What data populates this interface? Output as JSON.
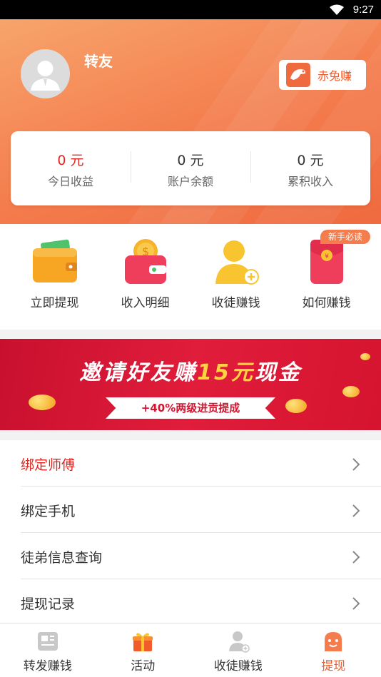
{
  "status_bar": {
    "time": "9:27"
  },
  "profile": {
    "username": "转友",
    "brand_name": "赤兔赚"
  },
  "stats": [
    {
      "value": "0 元",
      "label": "今日收益"
    },
    {
      "value": "0 元",
      "label": "账户余额"
    },
    {
      "value": "0 元",
      "label": "累积收入"
    }
  ],
  "quick_actions": [
    {
      "label": "立即提现",
      "icon": "wallet-icon"
    },
    {
      "label": "收入明细",
      "icon": "coin-purse-icon"
    },
    {
      "label": "收徒赚钱",
      "icon": "add-person-icon"
    },
    {
      "label": "如何赚钱",
      "icon": "red-envelope-icon"
    }
  ],
  "new_badge": "新手必读",
  "banner": {
    "title_part1": "邀请好友赚",
    "title_highlight": "15元",
    "title_part2": "现金",
    "subtitle": "+40%两级进贡提成"
  },
  "menu": [
    {
      "label": "绑定师傅",
      "highlight": true
    },
    {
      "label": "绑定手机"
    },
    {
      "label": "徒弟信息查询"
    },
    {
      "label": "提现记录"
    }
  ],
  "tabs": [
    {
      "label": "转发赚钱",
      "icon": "article-icon"
    },
    {
      "label": "活动",
      "icon": "gift-icon"
    },
    {
      "label": "收徒赚钱",
      "icon": "person-icon"
    },
    {
      "label": "提现",
      "icon": "mascot-icon",
      "active": true
    }
  ],
  "colors": {
    "accent": "#ef5a2a",
    "header_start": "#f7a46b",
    "header_end": "#ef6a3f",
    "red_value": "#e0261f",
    "banner_red": "#d5142f"
  }
}
